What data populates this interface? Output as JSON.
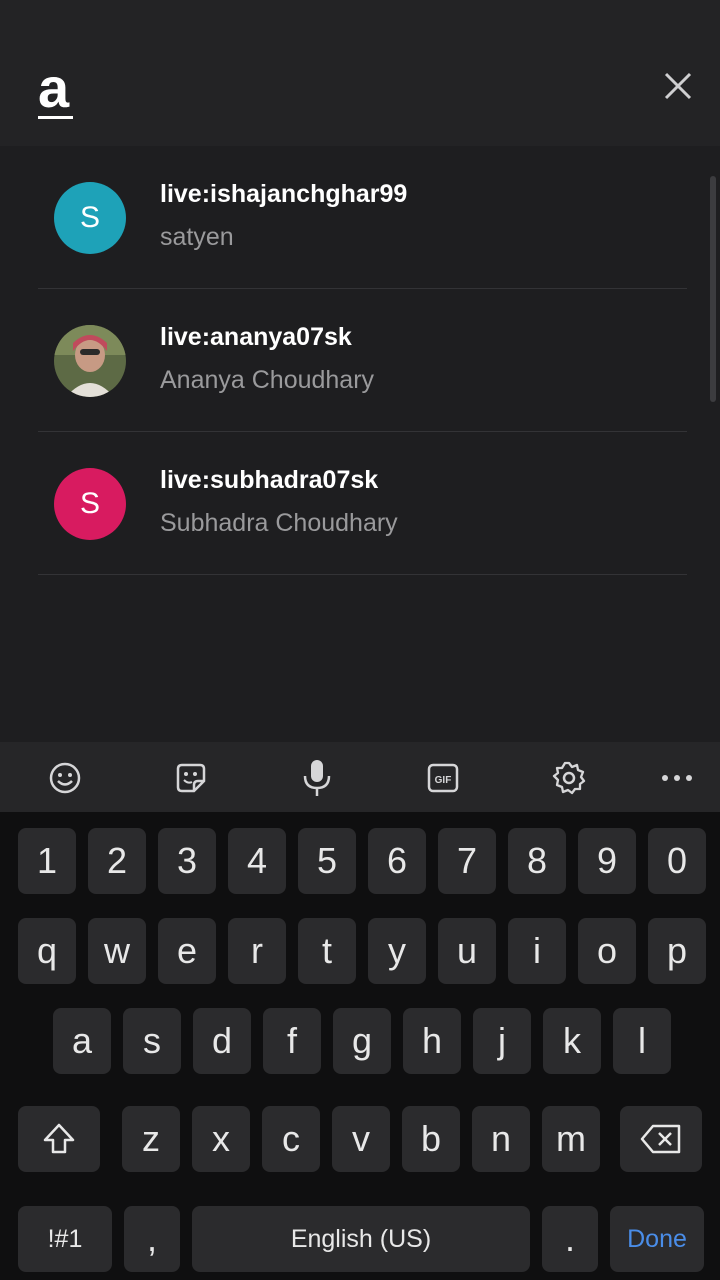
{
  "search": {
    "value": "a",
    "placeholder": "Search"
  },
  "results": [
    {
      "title": "live:ishajanchghar99",
      "subtitle": "satyen",
      "avatar_letter": "S",
      "avatar_color": "#1ea2b8"
    },
    {
      "title": "live:ananya07sk",
      "subtitle": "Ananya Choudhary",
      "avatar_letter": "",
      "avatar_color": "#6b6b52"
    },
    {
      "title": "live:subhadra07sk",
      "subtitle": "Subhadra Choudhary",
      "avatar_letter": "S",
      "avatar_color": "#d81b60"
    }
  ],
  "keyboard": {
    "toolbar_icons": [
      "emoji-icon",
      "sticker-icon",
      "microphone-icon",
      "gif-icon",
      "settings-gear-icon",
      "more-options-icon"
    ],
    "gif_label": "GIF",
    "numbers": [
      "1",
      "2",
      "3",
      "4",
      "5",
      "6",
      "7",
      "8",
      "9",
      "0"
    ],
    "row1": [
      "q",
      "w",
      "e",
      "r",
      "t",
      "y",
      "u",
      "i",
      "o",
      "p"
    ],
    "row2": [
      "a",
      "s",
      "d",
      "f",
      "g",
      "h",
      "j",
      "k",
      "l"
    ],
    "row3": [
      "z",
      "x",
      "c",
      "v",
      "b",
      "n",
      "m"
    ],
    "symbols_label": "!#1",
    "comma": ",",
    "space_label": "English (US)",
    "period": ".",
    "done_label": "Done"
  }
}
